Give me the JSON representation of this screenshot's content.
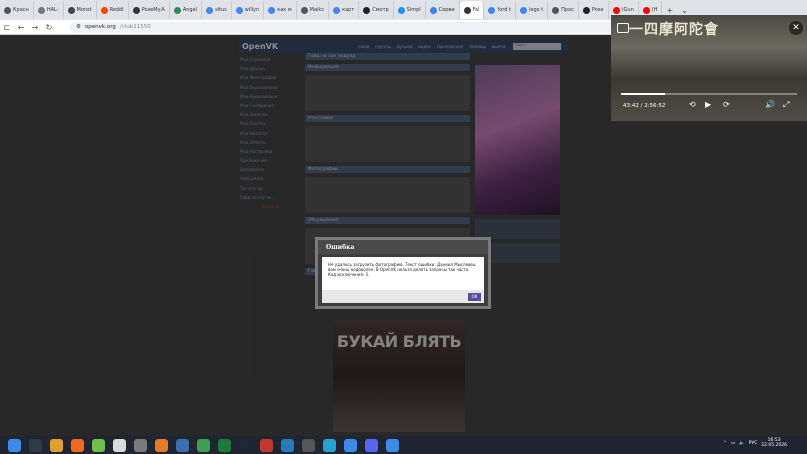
{
  "browser": {
    "tabs": [
      {
        "label": "Красн",
        "color": "#555"
      },
      {
        "label": "HAL-",
        "color": "#777"
      },
      {
        "label": "Monst",
        "color": "#444"
      },
      {
        "label": "Reddi",
        "color": "#ff4500"
      },
      {
        "label": "PoseMy.A",
        "color": "#333"
      },
      {
        "label": "Angel",
        "color": "#2e8b57"
      },
      {
        "label": "situs",
        "color": "#4285f4"
      },
      {
        "label": "willyn",
        "color": "#4285f4"
      },
      {
        "label": "как м",
        "color": "#4285f4"
      },
      {
        "label": "Maikc",
        "color": "#555"
      },
      {
        "label": "карт",
        "color": "#4285f4"
      },
      {
        "label": "Смотр",
        "color": "#222"
      },
      {
        "label": "Simpl",
        "color": "#1e90ff"
      },
      {
        "label": "Серви",
        "color": "#3b82f6"
      },
      {
        "label": "Fal",
        "color": "#333",
        "active": true
      },
      {
        "label": "ford t",
        "color": "#4285f4"
      },
      {
        "label": "lego t",
        "color": "#4285f4"
      },
      {
        "label": "Прос",
        "color": "#555"
      },
      {
        "label": "Pose",
        "color": "#222"
      },
      {
        "label": "(Gun",
        "color": "#ff0000"
      },
      {
        "label": "(H",
        "color": "#ff0000"
      }
    ],
    "url_host": "openvk.org",
    "url_path": "/club11550"
  },
  "site": {
    "logo": "OpenVK",
    "menu": [
      "люди",
      "группы",
      "музыка",
      "видео",
      "приложения",
      "помощь",
      "выйти"
    ],
    "search_placeholder": "Поиск",
    "left_menu": [
      "Моя Страница",
      "Мои Друзья",
      "Мои Фотографии",
      "Мои Видеозаписи",
      "Мои Аудиозаписи",
      "Мои Сообщения",
      "Мои Заметки",
      "Мои Группы",
      "Мои Новости",
      "Мои Ответы",
      "Мои Настройки",
      "",
      "Приложения",
      "Документы",
      "",
      "Чейнджлог",
      "Тот кто ты",
      "Гайд по сну по..."
    ],
    "left_news_title": "Новости",
    "center_title": "Гайд на сон подряд",
    "center_sections": [
      "Информация",
      "Участники",
      "Фотографии",
      "Обсуждения"
    ],
    "post_title": "Гайд на сон подряд опубликовал",
    "post_image_title": "БУКАЙ БЛЯТЬ"
  },
  "modal": {
    "title": "Ошибка",
    "message_line1": "Не удалось загрузить фотографию. Текст ошибки: Даниил Мыслевец",
    "message_line2": "вам очень недоволен. В OpenVK нельзя делать запросы так часто.",
    "message_line3": "Код исключения: 3.",
    "ok_label": "OK"
  },
  "pip": {
    "title_text": "一四摩阿陀會",
    "time_label": "43:42 / 2:56:52",
    "progress": 0.25
  },
  "taskbar": {
    "lang": "РУС",
    "time": "16:53",
    "date": "22.05.2026"
  }
}
